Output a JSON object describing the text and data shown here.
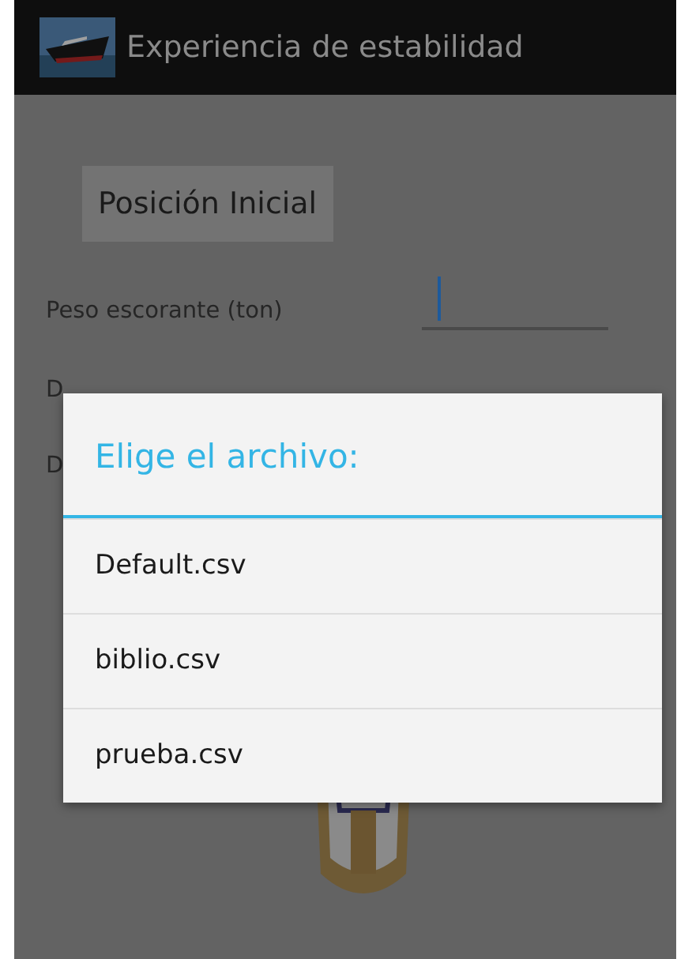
{
  "action_bar": {
    "title": "Experiencia de estabilidad"
  },
  "button": {
    "label": "Posición Inicial"
  },
  "field": {
    "label": "Peso escorante (ton)",
    "focused": true
  },
  "covered_labels": [
    "D",
    "D"
  ],
  "dialog": {
    "title": "Elige el archivo:",
    "items": [
      "Default.csv",
      "biblio.csv",
      "prueba.csv"
    ]
  }
}
